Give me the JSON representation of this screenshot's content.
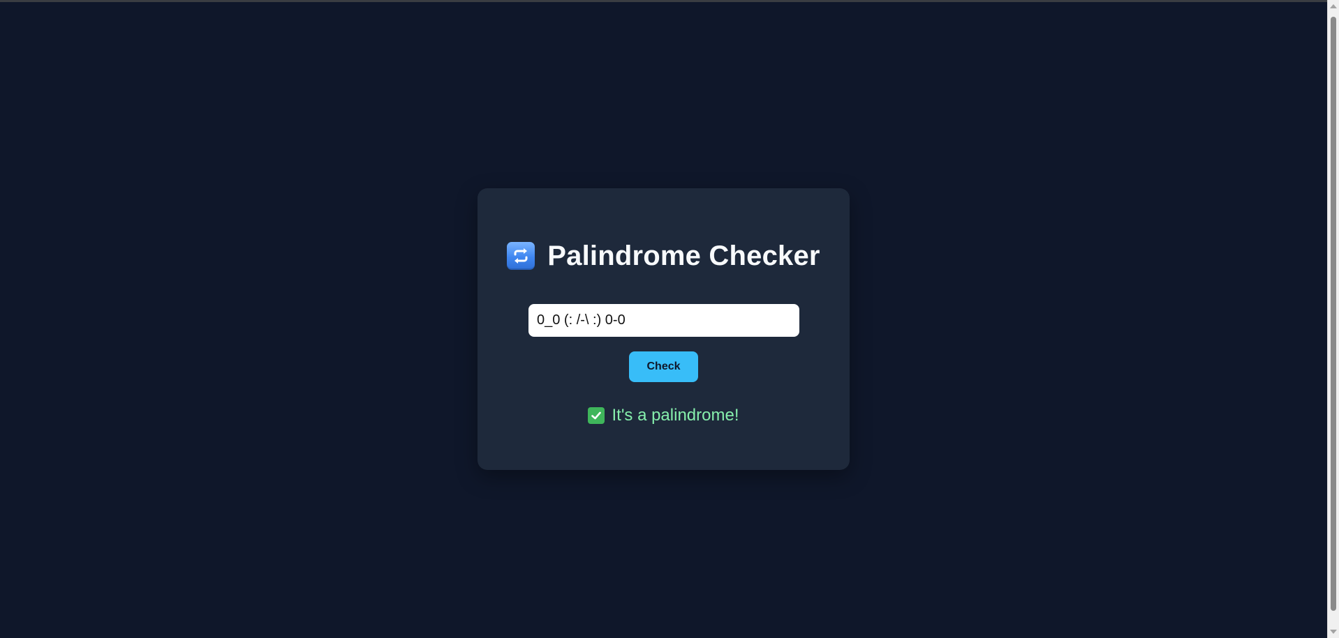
{
  "app": {
    "title": "Palindrome Checker",
    "title_icon": "repeat-arrows-icon"
  },
  "form": {
    "input_value": "0_0 (: /-\\ :) 0-0",
    "check_label": "Check"
  },
  "result": {
    "icon": "check-mark-button-icon",
    "text": "It's a palindrome!"
  },
  "colors": {
    "page_background": "#0f172a",
    "card_background": "#1e293b",
    "button_accent": "#38bdf8",
    "success_text": "#86efac"
  }
}
